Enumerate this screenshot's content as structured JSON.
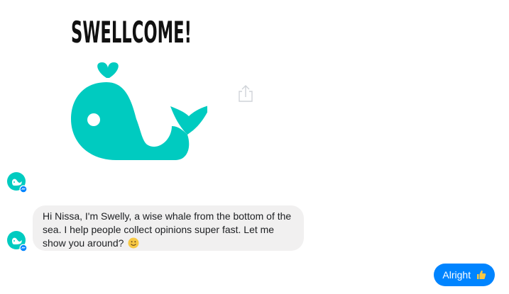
{
  "welcome_card": {
    "title": "SWELLCOME!",
    "image_icon": "whale-icon",
    "whale_color": "#00cbc0"
  },
  "share_button": {
    "icon": "share-icon"
  },
  "bot": {
    "avatar_icon": "whale-avatar-icon",
    "badge_icon": "messenger-badge-icon"
  },
  "messages": [
    {
      "from": "bot",
      "text": "Hi Nissa, I'm Swelly, a wise whale from the bottom of the sea. I help people collect opinions super fast. Let me show you around?",
      "emoji": "smile-emoji-icon"
    },
    {
      "from": "user",
      "text": "Alright",
      "emoji": "thumbs-up-icon"
    }
  ],
  "colors": {
    "incoming_bubble": "#f1f0f0",
    "outgoing_bubble": "#0084ff",
    "text": "#1c1e21",
    "accent": "#00cbc0"
  }
}
